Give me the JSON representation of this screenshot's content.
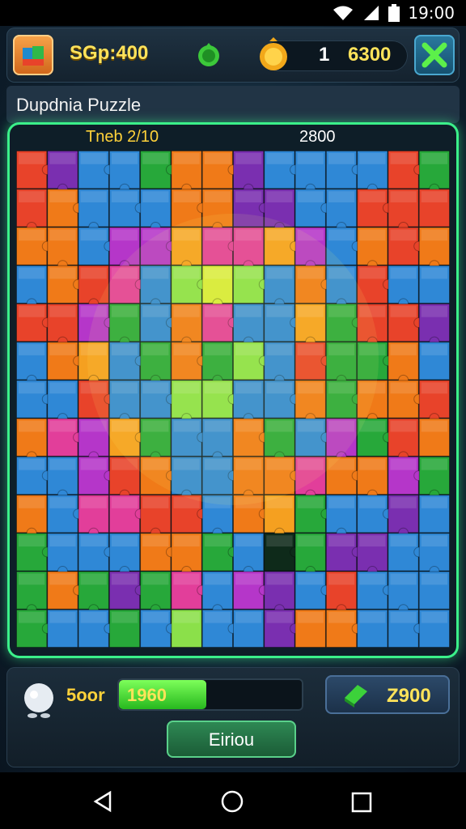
{
  "status_bar": {
    "time": "19:00"
  },
  "header": {
    "score_label": "SGp:400",
    "coin_count": "1",
    "coin_total": "6300"
  },
  "title": "Dupdnia Puzzle",
  "board": {
    "info_left": "Tneb 2/10",
    "info_right": "2800",
    "rows": 13,
    "cols": 14,
    "tiles": [
      [
        "#e8432a",
        "#7a2fb0",
        "#2f88d6",
        "#2f88d6",
        "#27a83a",
        "#f07a18",
        "#f07a18",
        "#7a2fb0",
        "#2f88d6",
        "#2f88d6",
        "#2f88d6",
        "#2f88d6",
        "#e8432a",
        "#27a83a"
      ],
      [
        "#e8432a",
        "#f07a18",
        "#2f88d6",
        "#2f88d6",
        "#2f88d6",
        "#f07a18",
        "#f07a18",
        "#7a2fb0",
        "#7a2fb0",
        "#2f88d6",
        "#2f88d6",
        "#e8432a",
        "#e8432a",
        "#e8432a"
      ],
      [
        "#f07a18",
        "#f07a18",
        "#2f88d6",
        "#b536c9",
        "#b536c9",
        "#f5a020",
        "#e23e9a",
        "#e23e9a",
        "#f5a020",
        "#b536c9",
        "#2f88d6",
        "#f07a18",
        "#e8432a",
        "#f07a18"
      ],
      [
        "#2f88d6",
        "#f07a18",
        "#e8432a",
        "#e23e9a",
        "#2f88d6",
        "#8be04a",
        "#d6ea3a",
        "#8be04a",
        "#2f88d6",
        "#f07a18",
        "#2f88d6",
        "#e8432a",
        "#2f88d6",
        "#2f88d6"
      ],
      [
        "#e8432a",
        "#e8432a",
        "#b536c9",
        "#27a83a",
        "#2f88d6",
        "#f07a18",
        "#e23e9a",
        "#2f88d6",
        "#2f88d6",
        "#f5a020",
        "#27a83a",
        "#e8432a",
        "#e8432a",
        "#7a2fb0"
      ],
      [
        "#2f88d6",
        "#f07a18",
        "#f5a020",
        "#2f88d6",
        "#27a83a",
        "#f07a18",
        "#27a83a",
        "#8be04a",
        "#2f88d6",
        "#e8432a",
        "#27a83a",
        "#27a83a",
        "#f07a18",
        "#2f88d6"
      ],
      [
        "#2f88d6",
        "#2f88d6",
        "#e8432a",
        "#2f88d6",
        "#2f88d6",
        "#8be04a",
        "#8be04a",
        "#2f88d6",
        "#2f88d6",
        "#f07a18",
        "#27a83a",
        "#f07a18",
        "#f07a18",
        "#e8432a"
      ],
      [
        "#f07a18",
        "#e23e9a",
        "#b536c9",
        "#f5a020",
        "#27a83a",
        "#2f88d6",
        "#2f88d6",
        "#f07a18",
        "#27a83a",
        "#2f88d6",
        "#b536c9",
        "#27a83a",
        "#e8432a",
        "#f07a18"
      ],
      [
        "#2f88d6",
        "#2f88d6",
        "#b536c9",
        "#e8432a",
        "#f07a18",
        "#2f88d6",
        "#2f88d6",
        "#f07a18",
        "#f07a18",
        "#e23e9a",
        "#f07a18",
        "#f07a18",
        "#b536c9",
        "#27a83a"
      ],
      [
        "#f07a18",
        "#2f88d6",
        "#e23e9a",
        "#e23e9a",
        "#e8432a",
        "#e8432a",
        "#2f88d6",
        "#f07a18",
        "#f5a020",
        "#27a83a",
        "#2f88d6",
        "#2f88d6",
        "#7a2fb0",
        "#2f88d6"
      ],
      [
        "#27a83a",
        "#2f88d6",
        "#2f88d6",
        "#2f88d6",
        "#f07a18",
        "#f07a18",
        "#27a83a",
        "#2f88d6",
        "#0e2a1a",
        "#27a83a",
        "#7a2fb0",
        "#7a2fb0",
        "#2f88d6",
        "#2f88d6"
      ],
      [
        "#27a83a",
        "#f07a18",
        "#27a83a",
        "#7a2fb0",
        "#27a83a",
        "#e23e9a",
        "#2f88d6",
        "#b536c9",
        "#7a2fb0",
        "#2f88d6",
        "#e8432a",
        "#2f88d6",
        "#2f88d6",
        "#2f88d6"
      ],
      [
        "#27a83a",
        "#2f88d6",
        "#2f88d6",
        "#27a83a",
        "#2f88d6",
        "#8be04a",
        "#2f88d6",
        "#2f88d6",
        "#7a2fb0",
        "#f07a18",
        "#f07a18",
        "#2f88d6",
        "#2f88d6",
        "#2f88d6"
      ]
    ]
  },
  "bottom": {
    "level_label": "5oor",
    "progress_text": "1960",
    "progress_fraction": 0.48,
    "gem_button_label": "Z900",
    "action_label": "Eiriou"
  }
}
